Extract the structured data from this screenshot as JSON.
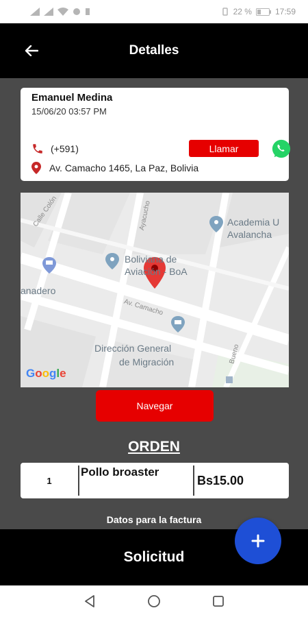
{
  "status_bar": {
    "battery": "22 %",
    "time": "17:59"
  },
  "app_bar": {
    "title": "Detalles"
  },
  "customer": {
    "name": "Emanuel Medina",
    "date": "15/06/20 03:57 PM",
    "phone": "(+591)",
    "call_label": "Llamar",
    "address": "Av. Camacho 1465, La Paz, Bolivia"
  },
  "map": {
    "labels": {
      "street_colon": "Calle Colón",
      "street_ayacucho": "Ayacucho",
      "academia_line1": "Academia U",
      "academia_line2": "Avalancha",
      "boliviana_line1": "Boliviana de",
      "boliviana_line2": "Aviación - BoA",
      "panadero": "anadero",
      "street_camacho": "Av. Camacho",
      "direccion_line1": "Dirección General",
      "direccion_line2": "de Migración",
      "street_bueno": "Bueno",
      "google": "Google"
    }
  },
  "navigate_label": "Navegar",
  "order": {
    "heading": "ORDEN",
    "items": [
      {
        "qty": "1",
        "product": "Pollo broaster",
        "price": "Bs15.00"
      }
    ]
  },
  "invoice_label": "Datos para la factura",
  "request_label": "Solicitud",
  "fab_label": "+",
  "colors": {
    "primary_red": "#e60000",
    "fab_blue": "#1e4fd6",
    "app_bar": "#000000",
    "background": "#4a4a4a"
  },
  "icons": [
    "back-arrow-icon",
    "phone-icon",
    "whatsapp-icon",
    "location-pin-icon",
    "map-marker-icon",
    "plus-icon",
    "back-triangle-icon",
    "home-circle-icon",
    "recents-square-icon"
  ]
}
